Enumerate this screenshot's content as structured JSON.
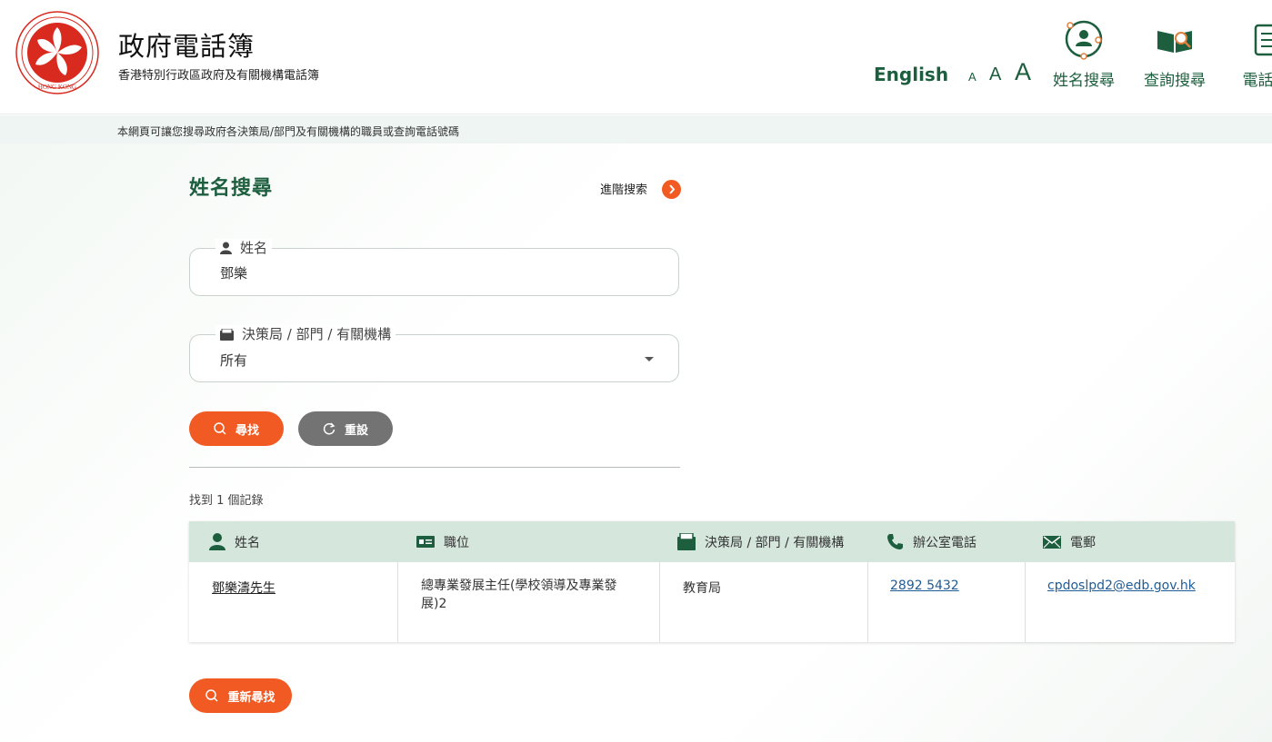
{
  "header": {
    "emblem_text": "HONG KONG",
    "title": "政府電話簿",
    "subtitle": "香港特別行政區政府及有關機構電話簿",
    "language_link": "English",
    "font_size_small": "A",
    "font_size_medium": "A",
    "font_size_large": "A",
    "nav": [
      {
        "label": "姓名搜尋",
        "icon": "person-search-icon"
      },
      {
        "label": "查詢搜尋",
        "icon": "book-magnifier-icon"
      },
      {
        "label": "電話簿",
        "icon": "scroll-list-icon"
      }
    ]
  },
  "info_strip": "本網頁可讓您搜尋政府各決策局/部門及有關機構的職員或查詢電話號碼",
  "search": {
    "title": "姓名搜尋",
    "advanced_link": "進階搜索",
    "name_field": {
      "label": "姓名",
      "value": "鄧樂"
    },
    "dept_field": {
      "label": "決策局 / 部門 / 有關機構",
      "value": "所有"
    },
    "search_button": "尋找",
    "reset_button": "重設"
  },
  "results": {
    "count_text": "找到 1 個記錄",
    "columns": [
      "姓名",
      "職位",
      "決策局 / 部門 / 有關機構",
      "辦公室電話",
      "電郵"
    ],
    "rows": [
      {
        "name": "鄧樂濤先生",
        "post": "總專業發展主任(學校領導及專業發展)2",
        "department": "教育局",
        "phone": "2892 5432",
        "email": "cpdoslpd2@edb.gov.hk"
      }
    ]
  },
  "search_again_button": "重新尋找",
  "colors": {
    "brand_green": "#1c5e3e",
    "accent_orange": "#f15a22",
    "header_row": "#d5e6dd",
    "reset_grey": "#737373"
  }
}
